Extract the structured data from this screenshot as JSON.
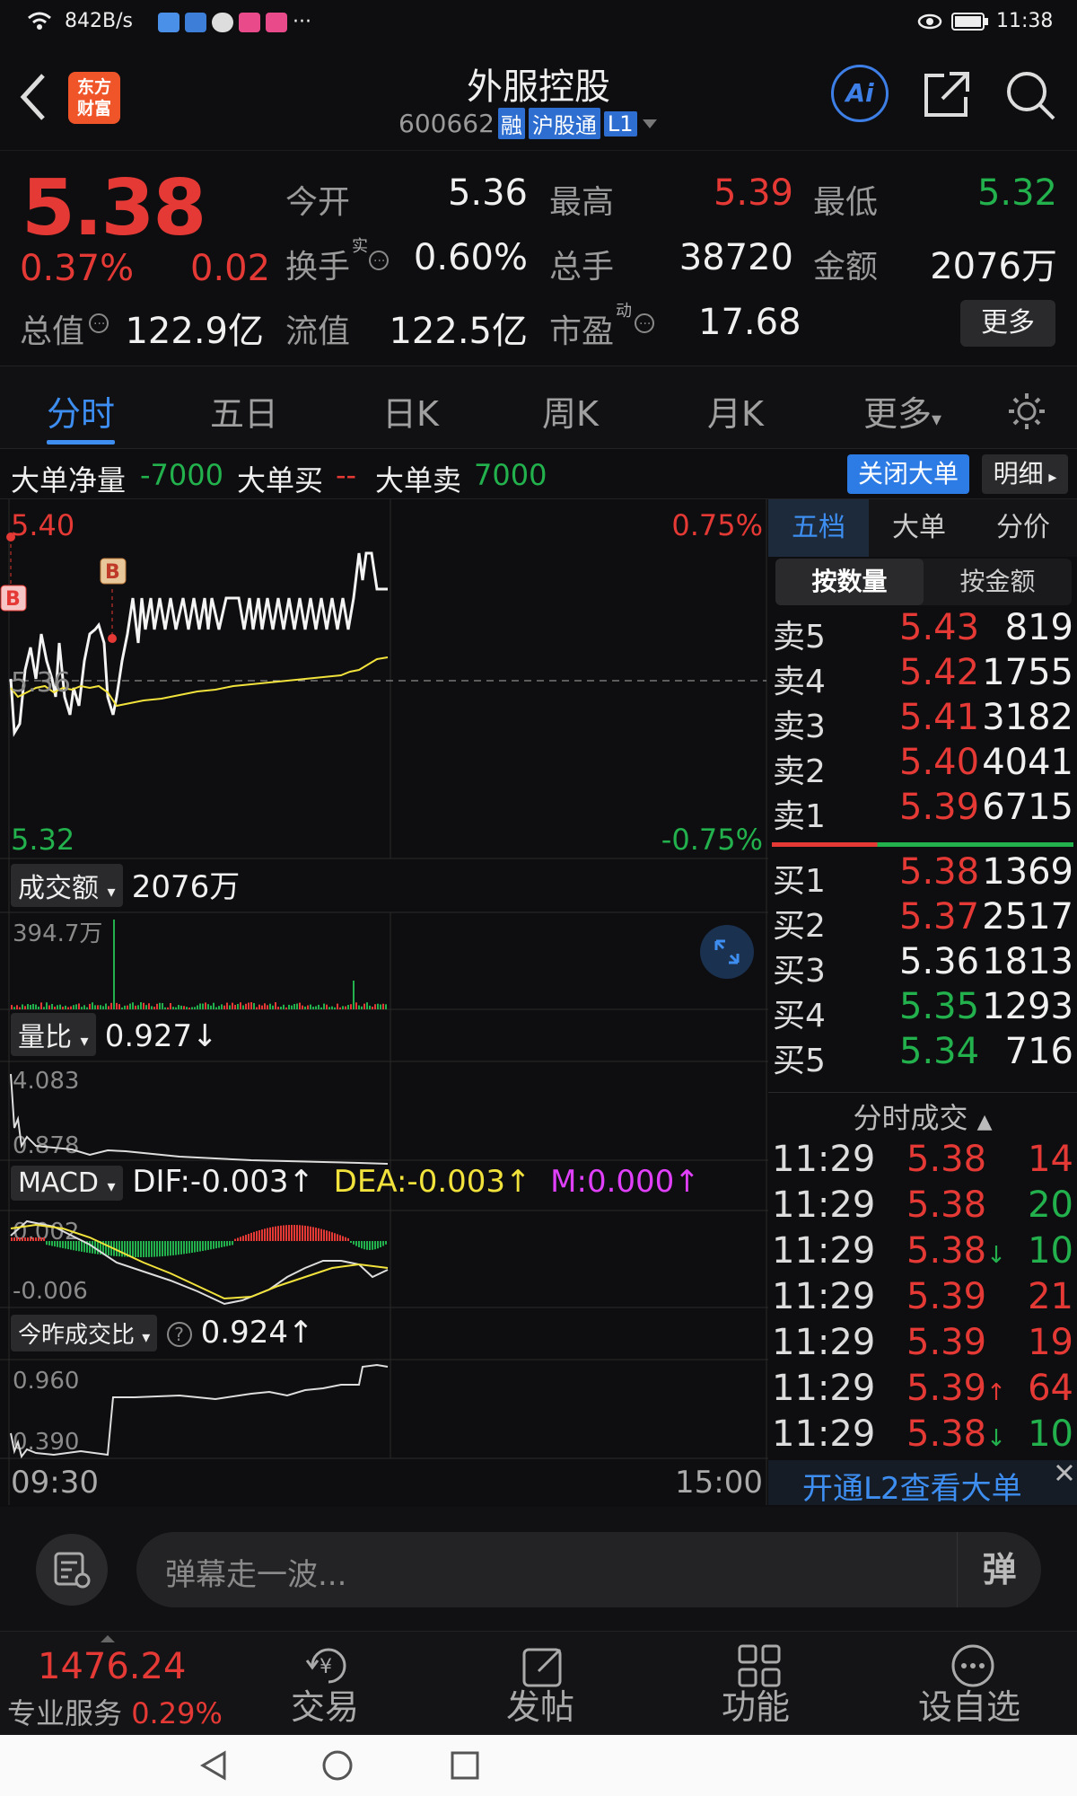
{
  "status": {
    "speed": "842B/s",
    "time": "11:38"
  },
  "header": {
    "logo_line1": "东方",
    "logo_line2": "财富",
    "title": "外服控股",
    "code": "600662",
    "tags": [
      "融",
      "沪股通",
      "L1"
    ],
    "ai": "Ai"
  },
  "quote": {
    "price": "5.38",
    "pct": "0.37%",
    "chg": "0.02",
    "fields": [
      {
        "label": "今开",
        "value": "5.36"
      },
      {
        "label": "最高",
        "value": "5.39"
      },
      {
        "label": "最低",
        "value": "5.32"
      },
      {
        "label": "换手",
        "value": "0.60%"
      },
      {
        "label": "总手",
        "value": "38720"
      },
      {
        "label": "金额",
        "value": "2076万"
      },
      {
        "label": "总值",
        "value": "122.9亿"
      },
      {
        "label": "流值",
        "value": "122.5亿"
      },
      {
        "label": "市盈",
        "value": "17.68"
      }
    ],
    "sup_shi": "实",
    "sup_dong": "动",
    "more": "更多"
  },
  "tabs": [
    "分时",
    "五日",
    "日K",
    "周K",
    "月K",
    "更多"
  ],
  "bigorder": {
    "net_label": "大单净量",
    "net": "-7000",
    "buy_label": "大单买",
    "buy": "--",
    "sell_label": "大单卖",
    "sell": "7000",
    "close_btn": "关闭大单",
    "detail_btn": "明细"
  },
  "chart": {
    "top_price": "5.40",
    "bottom_price": "5.32",
    "top_pct": "0.75%",
    "bottom_pct": "-0.75%",
    "mid_price": "5.36",
    "start_time": "09:30",
    "end_time": "15:00",
    "marker_b": "B"
  },
  "indicators": {
    "amount": {
      "name": "成交额",
      "value": "2076万",
      "axis": "394.7万"
    },
    "ratio": {
      "name": "量比",
      "value": "0.927",
      "axis_top": "4.083",
      "axis_bot": "0.878",
      "arrow": "↓"
    },
    "macd": {
      "name": "MACD",
      "dif": "DIF:-0.003",
      "dea": "DEA:-0.003",
      "m": "M:0.000",
      "arrow": "↑",
      "axis_top": "0.002",
      "axis_bot": "-0.006"
    },
    "tvr": {
      "name": "今昨成交比",
      "value": "0.924",
      "arrow": "↑",
      "axis_top": "0.960",
      "axis_bot": "0.390",
      "help": "?"
    }
  },
  "orderbook": {
    "tabs": [
      "五档",
      "大单",
      "分价"
    ],
    "sub_tabs": [
      "按数量",
      "按金额"
    ],
    "sells": [
      {
        "label": "卖5",
        "price": "5.43",
        "vol": "819"
      },
      {
        "label": "卖4",
        "price": "5.42",
        "vol": "1755"
      },
      {
        "label": "卖3",
        "price": "5.41",
        "vol": "3182"
      },
      {
        "label": "卖2",
        "price": "5.40",
        "vol": "4041"
      },
      {
        "label": "卖1",
        "price": "5.39",
        "vol": "6715"
      }
    ],
    "buys": [
      {
        "label": "买1",
        "price": "5.38",
        "vol": "1369"
      },
      {
        "label": "买2",
        "price": "5.37",
        "vol": "2517"
      },
      {
        "label": "买3",
        "price": "5.36",
        "vol": "1813"
      },
      {
        "label": "买4",
        "price": "5.35",
        "vol": "1293"
      },
      {
        "label": "买5",
        "price": "5.34",
        "vol": "716"
      }
    ]
  },
  "ticks": {
    "title": "分时成交",
    "rows": [
      {
        "time": "11:29",
        "price": "5.38",
        "arrow": "",
        "vol": "14"
      },
      {
        "time": "11:29",
        "price": "5.38",
        "arrow": "",
        "vol": "20"
      },
      {
        "time": "11:29",
        "price": "5.38",
        "arrow": "↓",
        "vol": "10"
      },
      {
        "time": "11:29",
        "price": "5.39",
        "arrow": "",
        "vol": "21"
      },
      {
        "time": "11:29",
        "price": "5.39",
        "arrow": "",
        "vol": "19"
      },
      {
        "time": "11:29",
        "price": "5.39",
        "arrow": "↑",
        "vol": "64"
      },
      {
        "time": "11:29",
        "price": "5.38",
        "arrow": "↓",
        "vol": "10"
      }
    ]
  },
  "l2": {
    "banner": "开通L2查看大单"
  },
  "comment": {
    "placeholder": "弹幕走一波...",
    "send": "弹"
  },
  "bottom": {
    "index_value": "1476.24",
    "service": "专业服务",
    "index_pct": "0.29%",
    "nav": [
      "交易",
      "发帖",
      "功能",
      "设自选"
    ]
  },
  "colors": {
    "up": "#e53935",
    "down": "#22b14c",
    "accent": "#2d7be5"
  }
}
